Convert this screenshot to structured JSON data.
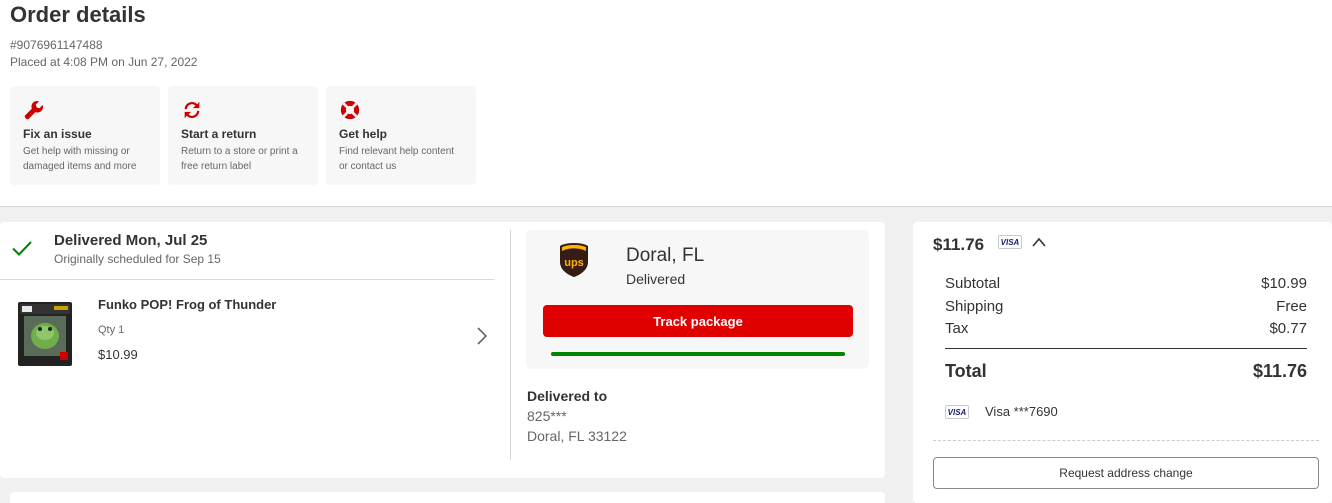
{
  "header": {
    "title": "Order details",
    "order_number": "#9076961147488",
    "placed": "Placed at 4:08 PM on Jun 27, 2022"
  },
  "actions": [
    {
      "icon": "wrench-icon",
      "title": "Fix an issue",
      "desc_line1": "Get help with missing or",
      "desc_line2": "damaged items and more"
    },
    {
      "icon": "return-arrows-icon",
      "title": "Start a return",
      "desc_line1": "Return to a store or print a",
      "desc_line2": "free return label"
    },
    {
      "icon": "lifebuoy-icon",
      "title": "Get help",
      "desc_line1": "Find relevant help content",
      "desc_line2": "or contact us"
    }
  ],
  "delivery": {
    "status": "Delivered Mon, Jul 25",
    "subtext": "Originally scheduled for Sep 15"
  },
  "product": {
    "name": "Funko POP! Frog of Thunder",
    "qty": "Qty 1",
    "price": "$10.99"
  },
  "shipment": {
    "carrier_icon": "ups-logo",
    "city": "Doral, FL",
    "status": "Delivered",
    "track_label": "Track package",
    "progress": 1.0,
    "delivered_to_label": "Delivered to",
    "address_line1": "825***",
    "address_line2": "Doral, FL 33122"
  },
  "summary": {
    "total_header": "$11.76",
    "rows": [
      {
        "label": "Subtotal",
        "value": "$10.99"
      },
      {
        "label": "Shipping",
        "value": "Free"
      },
      {
        "label": "Tax",
        "value": "$0.77"
      }
    ],
    "total_label": "Total",
    "total_value": "$11.76",
    "card_badge": "VISA",
    "payment_text": "Visa ***7690",
    "request_label": "Request address change"
  },
  "colors": {
    "accent_red": "#e00000",
    "success_green": "#008300",
    "ups_brown": "#351c15",
    "ups_gold": "#ffb500"
  }
}
